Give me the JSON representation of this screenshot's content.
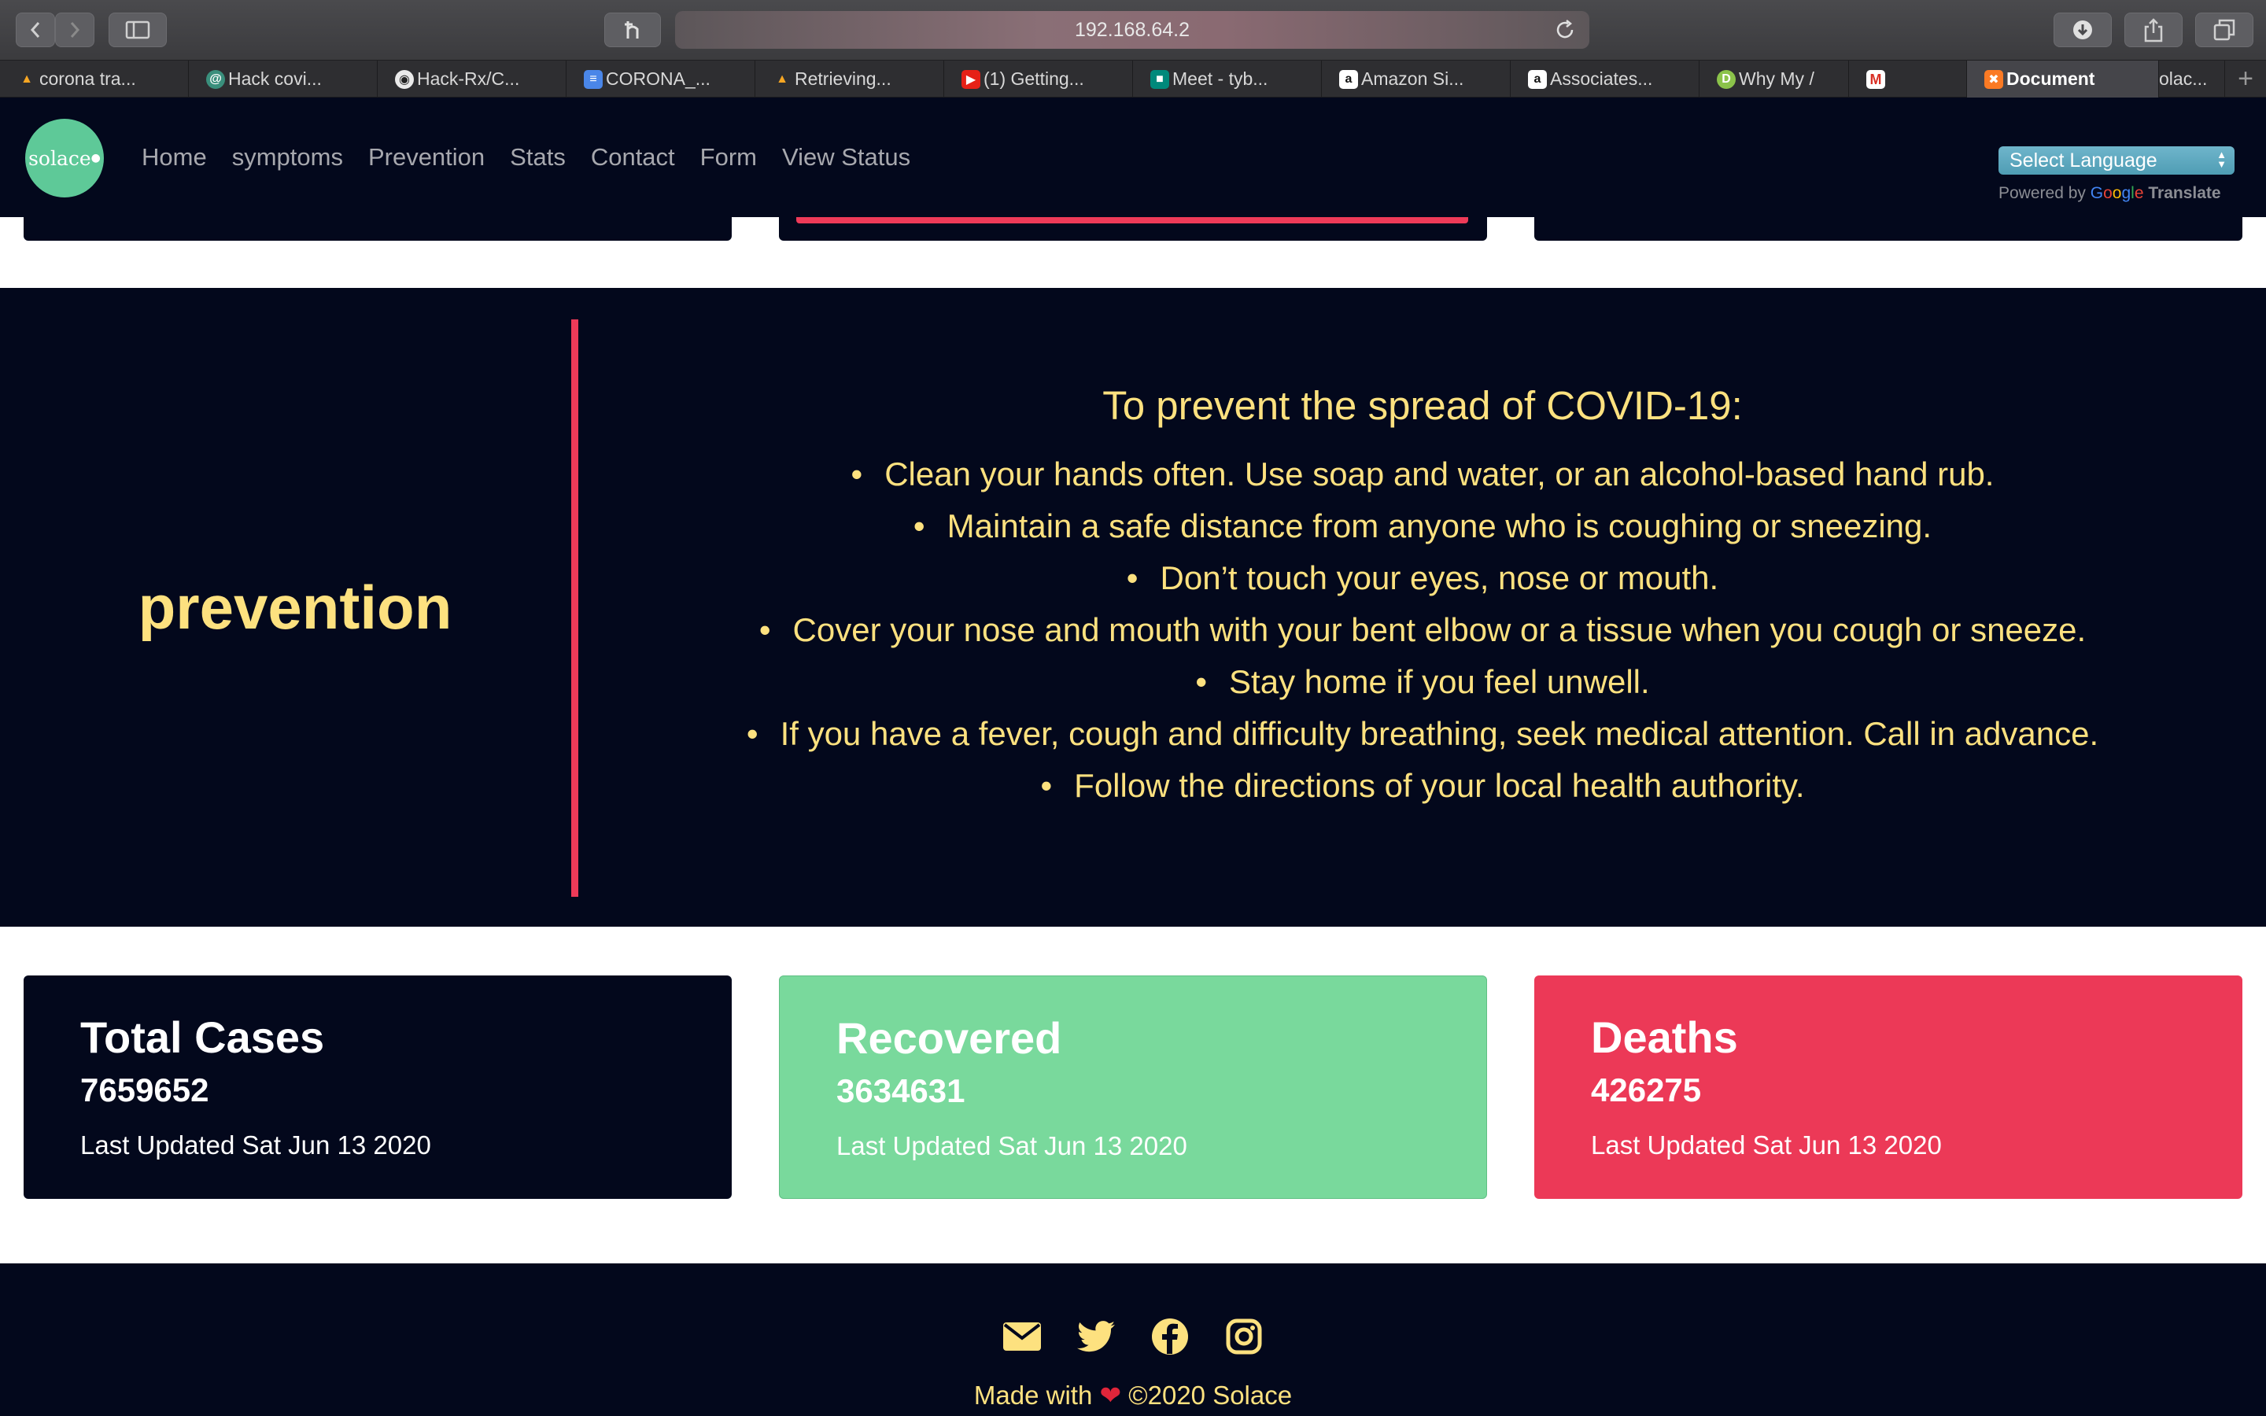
{
  "browser": {
    "url": "192.168.64.2",
    "tabs": [
      {
        "label": "corona tra...",
        "icon": "firebase-icon"
      },
      {
        "label": "Hack covi...",
        "icon": "globe-icon"
      },
      {
        "label": "Hack-Rx/C...",
        "icon": "github-icon"
      },
      {
        "label": "CORONA_...",
        "icon": "docs-icon"
      },
      {
        "label": "Retrieving...",
        "icon": "firebase-icon"
      },
      {
        "label": "(1) Getting...",
        "icon": "youtube-icon"
      },
      {
        "label": "Meet - tyb...",
        "icon": "meet-icon"
      },
      {
        "label": "Amazon Si...",
        "icon": "amazon-icon"
      },
      {
        "label": "Associates...",
        "icon": "amazon-icon"
      },
      {
        "label": "Why My /",
        "icon": "d-icon"
      },
      {
        "label": "",
        "icon": "gmail-icon"
      },
      {
        "label": "Document",
        "icon": "xampp-icon",
        "active": true
      },
      {
        "label": "olac...",
        "icon": ""
      }
    ]
  },
  "nav": {
    "logo": "solace",
    "links": [
      "Home",
      "symptoms",
      "Prevention",
      "Stats",
      "Contact",
      "Form",
      "View Status"
    ],
    "language_select": "Select Language",
    "powered_by": "Powered by",
    "google": "Google",
    "translate": "Translate"
  },
  "prevention": {
    "heading": "prevention",
    "title": "To prevent the spread of COVID-19:",
    "items": [
      "Clean your hands often. Use soap and water, or an alcohol-based hand rub.",
      "Maintain a safe distance from anyone who is coughing or sneezing.",
      "Don’t touch your eyes, nose or mouth.",
      "Cover your nose and mouth with your bent elbow or a tissue when you cough or sneeze.",
      "Stay home if you feel unwell.",
      "If you have a fever, cough and difficulty breathing, seek medical attention. Call in advance.",
      "Follow the directions of your local health authority."
    ]
  },
  "stats": [
    {
      "title": "Total Cases",
      "value": "7659652",
      "updated": "Last Updated Sat Jun 13 2020"
    },
    {
      "title": "Recovered",
      "value": "3634631",
      "updated": "Last Updated Sat Jun 13 2020"
    },
    {
      "title": "Deaths",
      "value": "426275",
      "updated": "Last Updated Sat Jun 13 2020"
    }
  ],
  "footer": {
    "icons": [
      "envelope-icon",
      "twitter-icon",
      "facebook-icon",
      "instagram-icon"
    ],
    "made_with": "Made with",
    "heart": "❤",
    "copyright": "©2020 Solace"
  },
  "colors": {
    "navy": "#03081c",
    "accent_yellow": "#fde17f",
    "accent_red": "#ee3a58",
    "green": "#79d99c",
    "logo_green": "#5ec998"
  }
}
